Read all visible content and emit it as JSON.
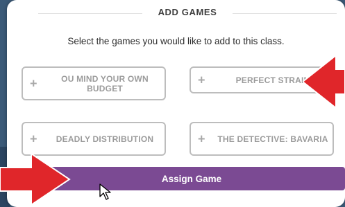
{
  "dialog": {
    "title": "ADD GAMES",
    "instructions": "Select the games you would like to add to this class."
  },
  "games": [
    {
      "label": "OU MIND YOUR OWN BUDGET",
      "icon": "plus-icon"
    },
    {
      "label": "PERFECT STRAIN",
      "icon": "plus-icon"
    },
    {
      "label": "DEADLY DISTRIBUTION",
      "icon": "plus-icon"
    },
    {
      "label": "THE DETECTIVE: BAVARIA",
      "icon": "plus-icon"
    }
  ],
  "plus_symbol": "+",
  "assign_button": {
    "label": "Assign Game"
  },
  "annotations": {
    "arrow_color": "#e0262a",
    "icon": "red-arrow-icon"
  },
  "colors": {
    "button": "#7b4a93",
    "background": "#3b5a78"
  }
}
